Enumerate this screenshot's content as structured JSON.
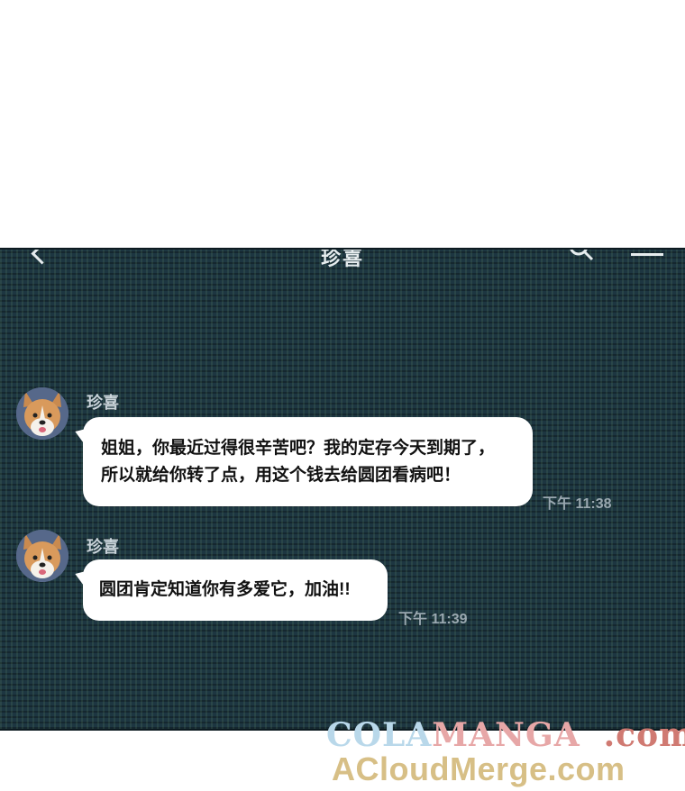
{
  "header": {
    "title": "珍喜"
  },
  "messages": [
    {
      "sender": "珍喜",
      "lines": [
        "姐姐，你最近过得很辛苦吧？我的定存今天到期了，",
        "所以就给你转了点，用这个钱去给圆团看病吧！"
      ],
      "time": "下午 11:38"
    },
    {
      "sender": "珍喜",
      "lines": [
        "圆团肯定知道你有多爱它，加油!!"
      ],
      "time": "下午 11:39"
    }
  ],
  "watermark": {
    "part1": "COLA",
    "part2": "MANGA",
    "part3": ".com",
    "line2": "ACloudMerge.com"
  },
  "colors": {
    "chat_background": "#1d3641",
    "bubble": "#ffffff",
    "header_text": "#e6ecee"
  },
  "icons": [
    "back-arrow-icon",
    "search-icon",
    "menu-icon",
    "corgi-avatar"
  ]
}
